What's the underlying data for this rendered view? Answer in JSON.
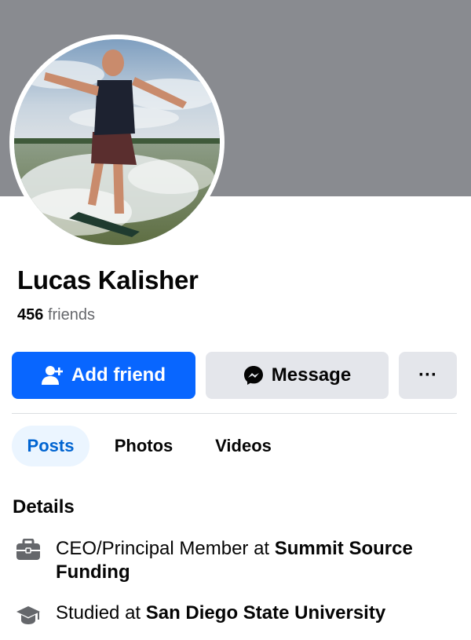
{
  "profile": {
    "name": "Lucas Kalisher",
    "friends_count": "456",
    "friends_label": "friends"
  },
  "actions": {
    "add_friend": "Add friend",
    "message": "Message",
    "more": "···"
  },
  "tabs": [
    {
      "label": "Posts",
      "active": true
    },
    {
      "label": "Photos",
      "active": false
    },
    {
      "label": "Videos",
      "active": false
    }
  ],
  "details": {
    "heading": "Details",
    "work": {
      "prefix": "CEO/Principal Member at ",
      "org": "Summit Source Funding"
    },
    "education": {
      "prefix": "Studied at ",
      "org": "San Diego State University"
    }
  },
  "colors": {
    "accent": "#0866ff",
    "cover": "#898b90",
    "secondary_button": "#e4e6eb",
    "active_tab_bg": "#ebf5ff",
    "active_tab_text": "#0064d1"
  },
  "icons": {
    "add_friend": "add-person-icon",
    "message": "messenger-icon",
    "work": "briefcase-icon",
    "education": "graduation-cap-icon"
  }
}
